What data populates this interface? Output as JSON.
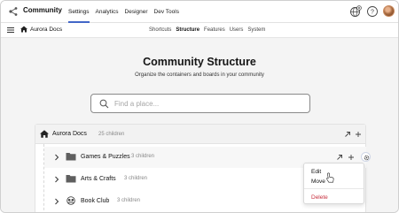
{
  "header": {
    "app_title": "Community",
    "nav": [
      "Settings",
      "Analytics",
      "Designer",
      "Dev Tools"
    ],
    "active_nav": "Settings",
    "icons": [
      "network-logo-icon",
      "globe-plus-icon",
      "help-icon",
      "avatar"
    ]
  },
  "subheader": {
    "breadcrumb": "Aurora Docs",
    "tabs": [
      "Shortcuts",
      "Structure",
      "Features",
      "Users",
      "System"
    ],
    "active_tab": "Structure"
  },
  "main": {
    "title": "Community Structure",
    "subtitle": "Organize the containers and boards in your community",
    "search_placeholder": "Find a place..."
  },
  "tree": {
    "root": {
      "name": "Aurora Docs",
      "count": "25 children"
    },
    "rows": [
      {
        "name": "Games & Puzzles",
        "count": "3 children",
        "icon": "folder-icon"
      },
      {
        "name": "Arts & Crafts",
        "count": "3 children",
        "icon": "folder-icon"
      },
      {
        "name": "Book Club",
        "count": "3 children",
        "icon": "group-icon"
      }
    ]
  },
  "context_menu": {
    "items": [
      "Edit",
      "Move",
      "Delete"
    ],
    "delete_color": "#c8303f"
  },
  "colors": {
    "accent": "#4267c8",
    "background": "#f4f4f4"
  }
}
